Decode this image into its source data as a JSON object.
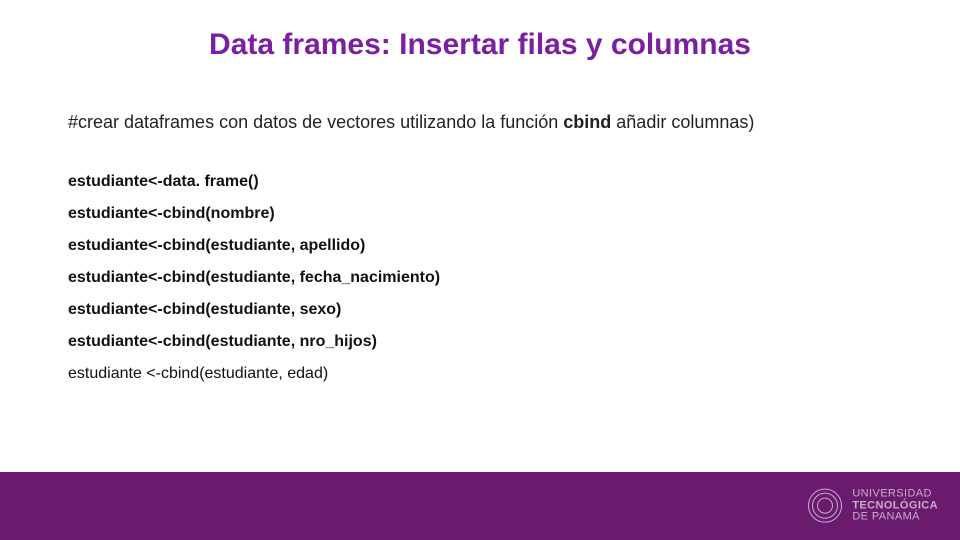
{
  "title": "Data frames: Insertar filas y columnas",
  "comment": {
    "prefix": "#crear dataframes con datos de vectores utilizando la función ",
    "keyword": "cbind",
    "suffix": " añadir columnas)"
  },
  "code": [
    {
      "text": "estudiante<-data. frame()",
      "bold": true
    },
    {
      "text": "estudiante<-cbind(nombre)",
      "bold": true
    },
    {
      "text": "estudiante<-cbind(estudiante, apellido)",
      "bold": true
    },
    {
      "text": "estudiante<-cbind(estudiante, fecha_nacimiento)",
      "bold": true
    },
    {
      "text": "estudiante<-cbind(estudiante, sexo)",
      "bold": true
    },
    {
      "text": "estudiante<-cbind(estudiante, nro_hijos)",
      "bold": true
    },
    {
      "text": "estudiante <-cbind(estudiante, edad)",
      "bold": false
    }
  ],
  "footer": {
    "line1": "UNIVERSIDAD",
    "line2": "TECNOLÓGICA",
    "line3": "DE PANAMÁ"
  }
}
